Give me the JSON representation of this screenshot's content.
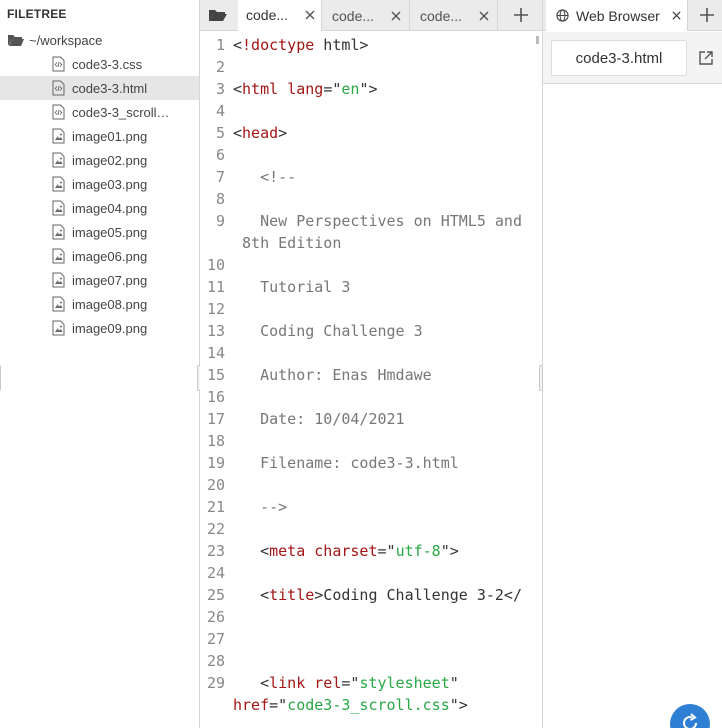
{
  "filetree": {
    "title": "FILETREE",
    "root_label": "~/workspace",
    "files": [
      {
        "name": "code3-3.css",
        "icon": "code-file-icon",
        "selected": false
      },
      {
        "name": "code3-3.html",
        "icon": "code-file-icon",
        "selected": true
      },
      {
        "name": "code3-3_scroll…",
        "icon": "code-file-icon",
        "selected": false
      },
      {
        "name": "image01.png",
        "icon": "image-file-icon",
        "selected": false
      },
      {
        "name": "image02.png",
        "icon": "image-file-icon",
        "selected": false
      },
      {
        "name": "image03.png",
        "icon": "image-file-icon",
        "selected": false
      },
      {
        "name": "image04.png",
        "icon": "image-file-icon",
        "selected": false
      },
      {
        "name": "image05.png",
        "icon": "image-file-icon",
        "selected": false
      },
      {
        "name": "image06.png",
        "icon": "image-file-icon",
        "selected": false
      },
      {
        "name": "image07.png",
        "icon": "image-file-icon",
        "selected": false
      },
      {
        "name": "image08.png",
        "icon": "image-file-icon",
        "selected": false
      },
      {
        "name": "image09.png",
        "icon": "image-file-icon",
        "selected": false
      }
    ]
  },
  "editor": {
    "tabs": [
      {
        "label": "code...",
        "active": true
      },
      {
        "label": "code...",
        "active": false
      },
      {
        "label": "code...",
        "active": false
      }
    ],
    "line_numbers": [
      "1",
      "2",
      "3",
      "4",
      "5",
      "6",
      "7",
      "8",
      "9",
      "10",
      "11",
      "12",
      "13",
      "14",
      "15",
      "16",
      "17",
      "18",
      "19",
      "20",
      "21",
      "22",
      "23",
      "24",
      "25",
      "26",
      "27",
      "28",
      "29"
    ],
    "code_lines": [
      "<!doctype html>",
      "<html lang=\"en\">",
      "<head>",
      "   <!--",
      "   New Perspectives on HTML5 and",
      " 8th Edition",
      "   Tutorial 3",
      "   Coding Challenge 3",
      "   Author: Enas Hmdawe",
      "   Date: 10/04/2021",
      "   Filename: code3-3.html",
      "   -->",
      "   <meta charset=\"utf-8\">",
      "   <title>Coding Challenge 3-2</",
      "   <link rel=\"stylesheet\"",
      "href=\"code3-3_scroll.css\">"
    ]
  },
  "browser": {
    "tab_label": "Web Browser",
    "address": "code3-3.html"
  },
  "colors": {
    "accent": "#2f7fd4",
    "tag": "#a31515",
    "string": "#28a745",
    "comment": "#777777",
    "selected_row": "#e6e6e6"
  }
}
